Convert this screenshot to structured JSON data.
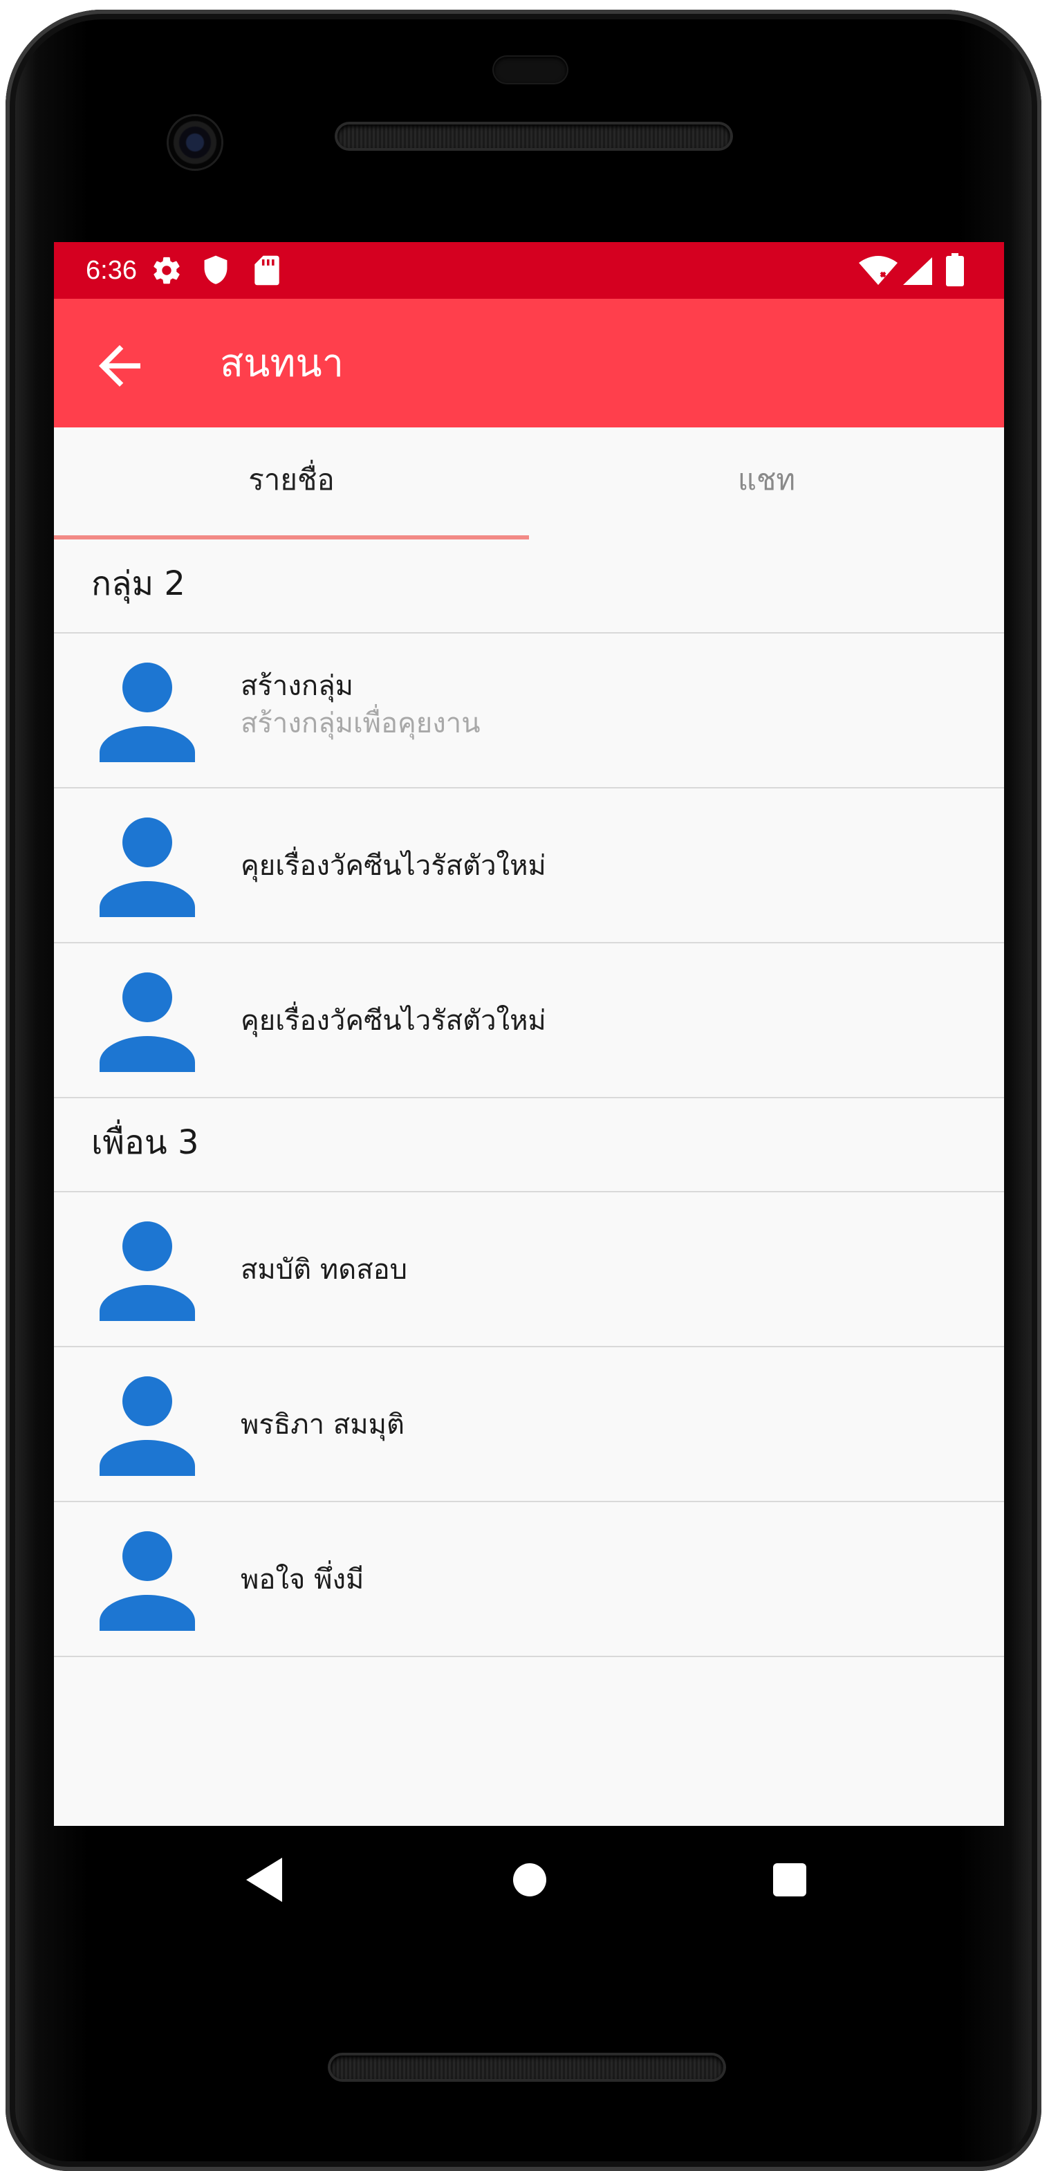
{
  "status_bar": {
    "time": "6:36",
    "left_icons": [
      "gear-icon",
      "shield-icon",
      "sd-card-icon"
    ],
    "right_icons": [
      "wifi-icon",
      "signal-icon",
      "battery-icon"
    ],
    "color": "#d50020"
  },
  "app_bar": {
    "title": "สนทนา",
    "back_icon": "arrow-left-icon",
    "color": "#ff3f4c"
  },
  "tabs": [
    {
      "label": "รายชื่อ",
      "active": true
    },
    {
      "label": "แชท",
      "active": false
    }
  ],
  "sections": [
    {
      "title": "กลุ่ม 2",
      "items": [
        {
          "title": "สร้างกลุ่ม",
          "subtitle": "สร้างกลุ่มเพื่อคุยงาน"
        },
        {
          "title": "คุยเรื่องวัคซีนไวรัสตัวใหม่"
        },
        {
          "title": "คุยเรื่องวัคซีนไวรัสตัวใหม่"
        }
      ]
    },
    {
      "title": "เพื่อน 3",
      "items": [
        {
          "title": "สมบัติ ทดสอบ"
        },
        {
          "title": "พรธิภา สมมุติ"
        },
        {
          "title": "พอใจ พึ่งมี"
        }
      ]
    }
  ],
  "avatar_icon": "person-icon",
  "avatar_color": "#1d76d2",
  "nav_bar": [
    "back-triangle-icon",
    "home-circle-icon",
    "recents-square-icon"
  ]
}
